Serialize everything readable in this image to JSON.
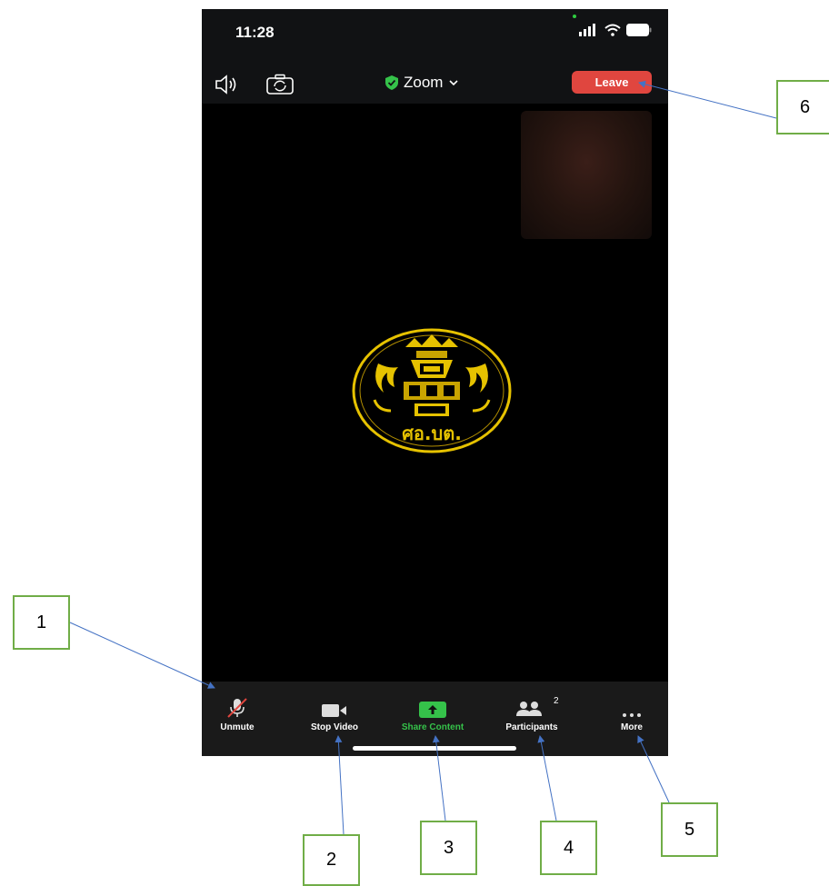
{
  "status_bar": {
    "time": "11:28"
  },
  "top_bar": {
    "meeting_title": "Zoom",
    "leave_label": "Leave"
  },
  "toolbar": {
    "unmute_label": "Unmute",
    "stop_video_label": "Stop Video",
    "share_label": "Share Content",
    "participants_label": "Participants",
    "participants_count": "2",
    "more_label": "More"
  },
  "seal": {
    "text": "ศอ.บต."
  },
  "callouts": [
    "1",
    "2",
    "3",
    "4",
    "5",
    "6"
  ],
  "colors": {
    "leave": "#e0463f",
    "share": "#35c24a",
    "encryption_shield": "#35c24a",
    "seal_gold": "#e6c200",
    "callout_border": "#70ad47",
    "arrow": "#4472c4"
  },
  "icons": [
    "speaker-icon",
    "camera-flip-icon",
    "shield-check-icon",
    "chevron-down-icon",
    "mic-muted-icon",
    "video-camera-icon",
    "share-arrow-icon",
    "participants-icon",
    "more-dots-icon",
    "signal-icon",
    "wifi-icon",
    "battery-icon"
  ]
}
